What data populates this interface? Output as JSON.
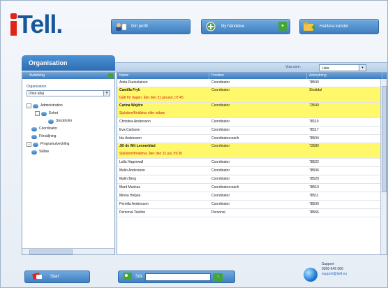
{
  "brand": {
    "logo_text": "Tell."
  },
  "header": {
    "profile_label": "Din profil",
    "new_task_label": "Ny händelse",
    "customer_label": "Hantera kunder"
  },
  "panel": {
    "title": "Organisation",
    "view_label": "Visa som:",
    "view_value": "Lista"
  },
  "left": {
    "header": "Avdelning",
    "org_label": "Organisation",
    "org_value": "(Visa alla)",
    "tree": [
      {
        "label": "Administration",
        "level": 0,
        "expander": "–"
      },
      {
        "label": "Enhet",
        "level": 1,
        "expander": "–"
      },
      {
        "label": "Stockholm",
        "level": 2,
        "expander": ""
      },
      {
        "label": "Coordinator",
        "level": 0,
        "expander": ""
      },
      {
        "label": "Försäljning",
        "level": 0,
        "expander": ""
      },
      {
        "label": "Programutveckling",
        "level": 0,
        "expander": "+"
      },
      {
        "label": "Skåne",
        "level": 0,
        "expander": ""
      }
    ]
  },
  "table": {
    "columns": [
      "Namn",
      "Position",
      "Anknytning"
    ],
    "rows": [
      {
        "name": "Anita Ruokolainen",
        "position": "Coordinator",
        "ext": "78500",
        "note": ""
      },
      {
        "name": "Camilla Fryk",
        "position": "Coordinator",
        "ext": "Skottdal",
        "note": "Gått för dagen, åter den 31 januari, 07:45"
      },
      {
        "name": "Carina Wejdro",
        "position": "Coordinator",
        "ext": "73540",
        "note": "Sjukdom/föräldrar eller vidare"
      },
      {
        "name": "Christina Andersson",
        "position": "Coordinator",
        "ext": "78119",
        "note": ""
      },
      {
        "name": "Eva Carlsson",
        "position": "Coordinator",
        "ext": "78117",
        "note": ""
      },
      {
        "name": "Ida Andersson",
        "position": "Coordinatorcoach",
        "ext": "78504",
        "note": ""
      },
      {
        "name": "Jill de Wit Lennerblad",
        "position": "Coordinator",
        "ext": "73580",
        "note": "Sjukdom/föräldrar, åter den 31 juli, 09:30"
      },
      {
        "name": "Lalla Hagerwall",
        "position": "Coordinator",
        "ext": "78522",
        "note": ""
      },
      {
        "name": "Malin Andersson",
        "position": "Coordinator",
        "ext": "78506",
        "note": ""
      },
      {
        "name": "Malin Berg",
        "position": "Coordinator",
        "ext": "78520",
        "note": ""
      },
      {
        "name": "Marit Munkaz",
        "position": "Coordinatorcoach",
        "ext": "78510",
        "note": ""
      },
      {
        "name": "Minna Heljula",
        "position": "Coordinator",
        "ext": "78511",
        "note": ""
      },
      {
        "name": "Pernilla Andersson",
        "position": "Coordinator",
        "ext": "78500",
        "note": ""
      },
      {
        "name": "Personal Telefon",
        "position": "Personal",
        "ext": "78566",
        "note": ""
      }
    ]
  },
  "footer": {
    "start_label": "Start",
    "search_label": "Sök",
    "support_title": "Support",
    "support_phone": "0200-645 000",
    "support_email": "support@itell.nu"
  },
  "colors": {
    "accent": "#3f7fc0",
    "highlight": "#fff86a",
    "alert": "#d3150e",
    "logo_red": "#e2231a",
    "logo_blue": "#17579b"
  }
}
